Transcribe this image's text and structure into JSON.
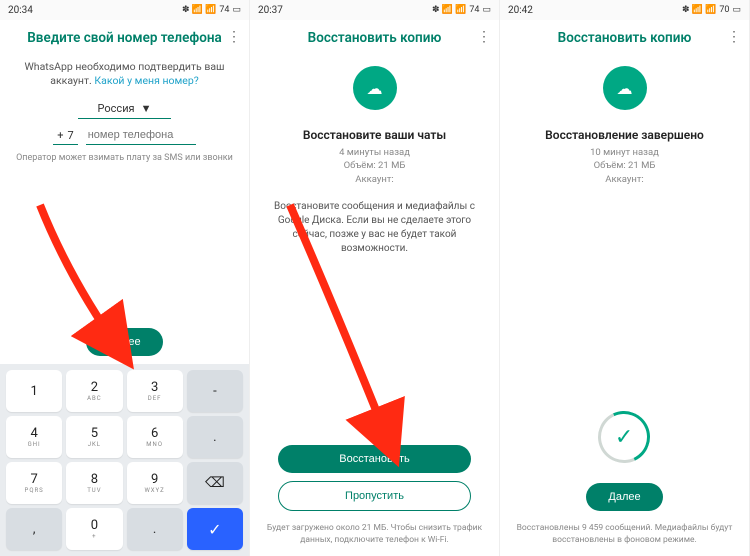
{
  "screens": [
    {
      "status_time": "20:34",
      "status_battery": "74",
      "title": "Введите свой номер телефона",
      "desc_pre": "WhatsApp необходимо подтвердить ваш аккаунт. ",
      "desc_link": "Какой у меня номер?",
      "country": "Россия",
      "cc_plus": "+",
      "cc_code": "7",
      "phone_placeholder": "номер телефона",
      "hint": "Оператор может взимать плату за SMS или звонки",
      "next_btn": "Далее"
    },
    {
      "status_time": "20:37",
      "status_battery": "74",
      "title": "Восстановить копию",
      "sub_title": "Восстановите ваши чаты",
      "meta_time": "4 минуты назад",
      "meta_size": "Объём: 21 МБ",
      "meta_acct": "Аккаунт:",
      "long_desc": "Восстановите сообщения и медиафайлы с Google Диска. Если вы не сделаете этого сейчас, позже у вас не будет такой возможности.",
      "restore_btn": "Восстановить",
      "skip_btn": "Пропустить",
      "foot": "Будет загружено около 21 МБ. Чтобы снизить трафик данных, подключите телефон к Wi-Fi."
    },
    {
      "status_time": "20:42",
      "status_battery": "70",
      "title": "Восстановить копию",
      "sub_title": "Восстановление завершено",
      "meta_time": "10 минут назад",
      "meta_size": "Объём: 21 МБ",
      "meta_acct": "Аккаунт:",
      "next_btn": "Далее",
      "foot": "Восстановлены 9 459 сообщений. Медиафайлы будут восстановлены в фоновом режиме."
    }
  ],
  "keypad": {
    "r1": [
      {
        "n": "1",
        "s": ""
      },
      {
        "n": "2",
        "s": "ABC"
      },
      {
        "n": "3",
        "s": "DEF"
      }
    ],
    "r2": [
      {
        "n": "4",
        "s": "GHI"
      },
      {
        "n": "5",
        "s": "JKL"
      },
      {
        "n": "6",
        "s": "MNO"
      }
    ],
    "r3": [
      {
        "n": "7",
        "s": "PQRS"
      },
      {
        "n": "8",
        "s": "TUV"
      },
      {
        "n": "9",
        "s": "WXYZ"
      }
    ],
    "r4": [
      {
        "n": "0",
        "s": "+"
      }
    ],
    "minus": "-",
    "dot": ".",
    "comma": ",",
    "backspace": "⌫",
    "ok": "✓"
  }
}
